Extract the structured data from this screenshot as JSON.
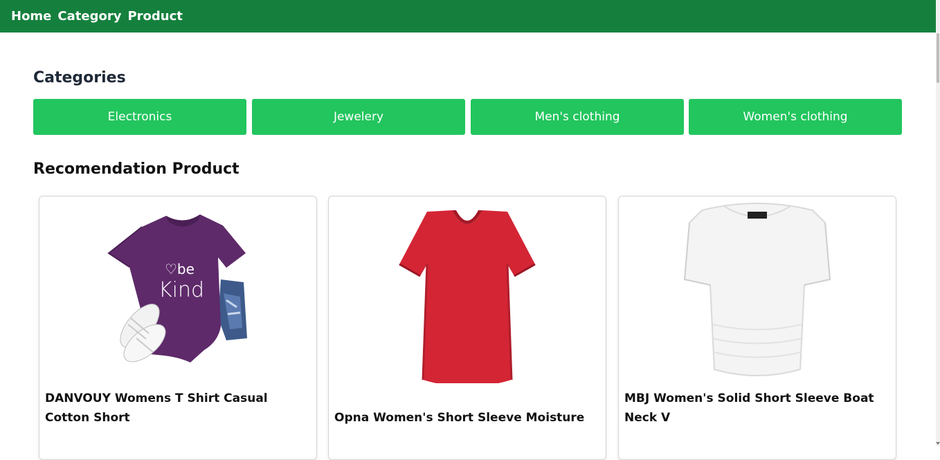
{
  "nav": {
    "links": [
      "Home",
      "Category",
      "Product"
    ]
  },
  "categories": {
    "title": "Categories",
    "items": [
      "Electronics",
      "Jewelery",
      "Men's clothing",
      "Women's clothing"
    ]
  },
  "recommendation": {
    "title": "Recomendation Product",
    "products": [
      {
        "title": "DANVOUY Womens T Shirt Casual Cotton Short",
        "image": "purple-be-kind-tshirt-icon"
      },
      {
        "title": "Opna Women's Short Sleeve Moisture",
        "image": "red-vneck-tshirt-icon"
      },
      {
        "title": "MBJ Women's Solid Short Sleeve Boat Neck V",
        "image": "white-boatneck-top-icon"
      }
    ]
  },
  "colors": {
    "navbar": "#15803d",
    "category_button": "#22c55e"
  }
}
